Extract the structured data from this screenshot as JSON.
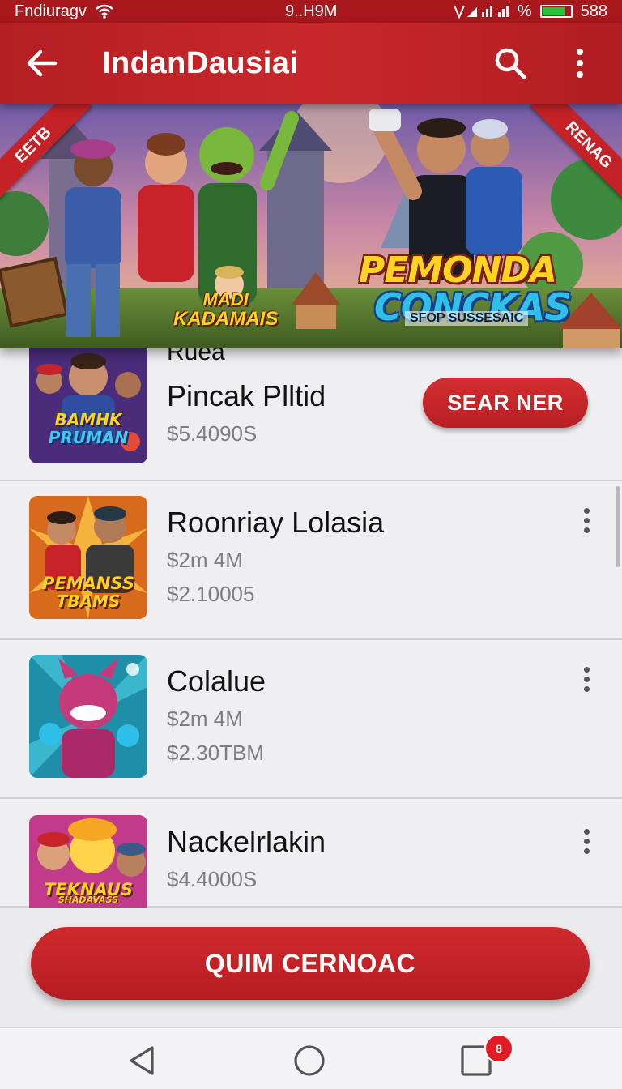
{
  "status_bar": {
    "carrier": "Fndiuragv",
    "time": "9..H9M",
    "battery_text": "%",
    "battery_level": "588"
  },
  "app_bar": {
    "title": "IndanDausiai",
    "back_icon": "arrow-left-icon",
    "search_icon": "search-icon",
    "more_icon": "more-vertical-icon"
  },
  "banner": {
    "ribbon_left": "EETB",
    "ribbon_right": "RENAG",
    "logo_line1": "PEMONDA",
    "logo_line2": "CONCKAS",
    "logo_sub": "SFOP SUSSESAIC",
    "mini_logo_line1": "MADI",
    "mini_logo_line2": "KADAMAIS"
  },
  "items": [
    {
      "kicker": "Ruea",
      "title": "Pincak Plltid",
      "subtitle": "$5.4090S",
      "action_label": "SEAR NER",
      "thumb_text1": "BAMHK",
      "thumb_text2": "PRUMAN"
    },
    {
      "title": "Roonriay Lolasia",
      "subtitle": "$2m 4M",
      "subtitle2": "$2.10005",
      "thumb_text1": "PEMANSS",
      "thumb_text2": "TBAMS"
    },
    {
      "title": "Colalue",
      "subtitle": "$2m 4M",
      "subtitle2": "$2.30TBM"
    },
    {
      "title": "Nackelrlakin",
      "subtitle": "$4.4000S",
      "thumb_text1": "TEKNAUS",
      "thumb_text2": "SHADAVASS"
    }
  ],
  "cta": {
    "label": "QUIM CERNOAC"
  },
  "nav": {
    "back": "nav-back-icon",
    "home": "nav-home-icon",
    "recents": "nav-recents-icon",
    "badge": "8"
  },
  "colors": {
    "primary": "#c8282b",
    "primary_dark": "#a8181d",
    "text_secondary": "#7d7d84",
    "background": "#ececef"
  }
}
